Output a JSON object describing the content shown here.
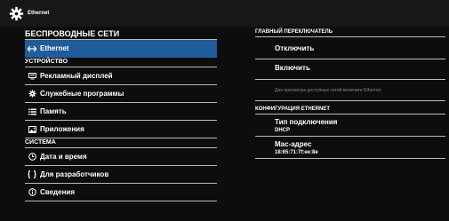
{
  "window": {
    "title": "Ethernet",
    "title_icon": "gear-icon"
  },
  "left": {
    "header": "БЕСПРОВОДНЫЕ СЕТИ",
    "selected_item": {
      "label": "Ethernet",
      "icon": "arrows-horizontal-icon"
    },
    "sections": [
      {
        "title": "УСТРОЙСТВО",
        "items": [
          {
            "label": "Рекламный дисплей",
            "icon": "display-icon"
          },
          {
            "label": "Служебные программы",
            "icon": "gear-icon"
          },
          {
            "label": "Память",
            "icon": "list-icon"
          },
          {
            "label": "Приложения",
            "icon": "image-icon"
          }
        ]
      },
      {
        "title": "СИСТЕМА",
        "items": [
          {
            "label": "Дата и время",
            "icon": "clock-icon"
          },
          {
            "label": "Для разработчиков",
            "icon": "braces-icon"
          },
          {
            "label": "Сведения",
            "icon": "info-icon"
          }
        ]
      }
    ]
  },
  "right": {
    "main_switch_header": "ГЛАВНЫЙ ПЕРЕКЛЮЧАТЕЛЬ",
    "disable_label": "Отключить",
    "enable_label": "Включить",
    "hint": "Для просмотра доступных сетей включите Ethernet.",
    "config_header": "КОНФИГУРАЦИЯ ETHERNET",
    "connection_type_label": "Тип подключения",
    "connection_type_value": "DHCP",
    "mac_label": "Mac-адрес",
    "mac_value": "18:65:71:7f:ee:8e"
  },
  "colors": {
    "selected_bg": "#1f5c9a",
    "titlebar_bg": "#171717"
  }
}
